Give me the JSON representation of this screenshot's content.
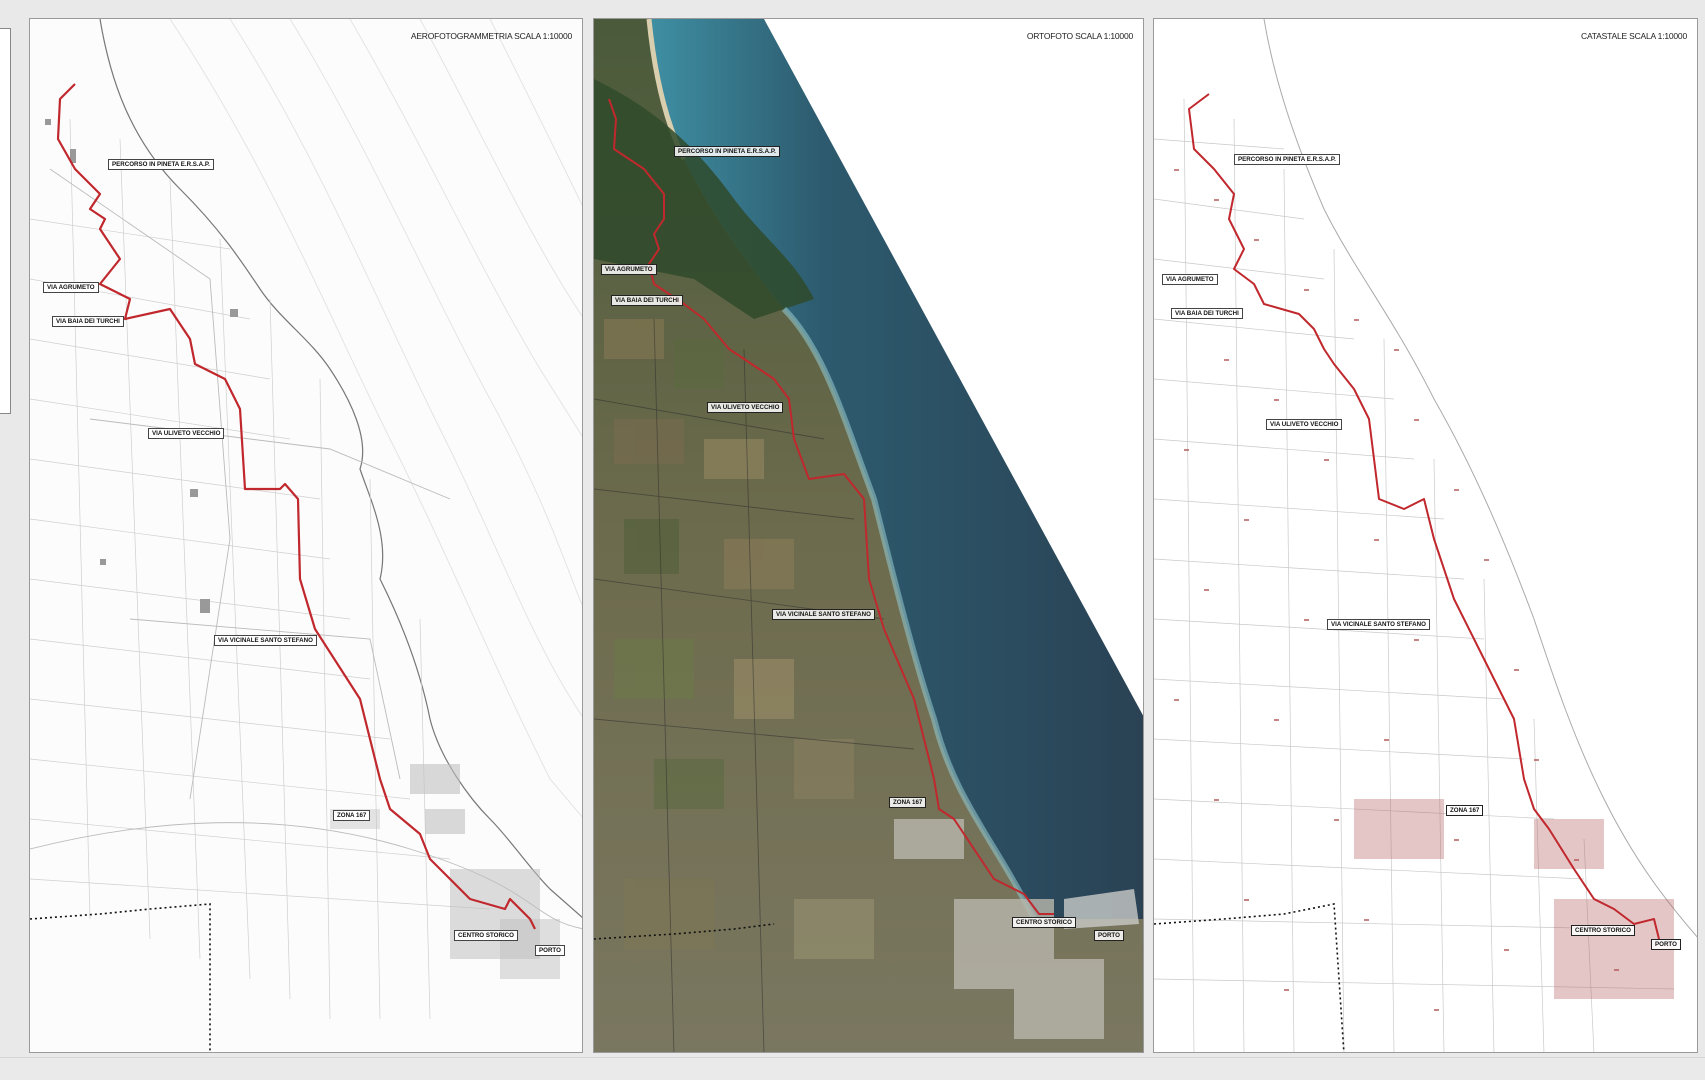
{
  "panels": [
    {
      "id": "aero",
      "title": "AEROFOTOGRAMMETRIA SCALA 1:10000"
    },
    {
      "id": "orto",
      "title": "ORTOFOTO SCALA 1:10000"
    },
    {
      "id": "cata",
      "title": "CATASTALE SCALA 1:10000"
    }
  ],
  "labels": {
    "pineta": "PERCORSO IN PINETA E.R.S.A.P.",
    "agrumeto": "VIA AGRUMETO",
    "baia": "VIA BAIA DEI TURCHI",
    "uliveto": "VIA ULIVETO VECCHIO",
    "stefano": "VIA VICINALE SANTO STEFANO",
    "zona": "ZONA 167",
    "centro": "CENTRO STORICO",
    "porto": "PORTO"
  },
  "colors": {
    "route": "#c0282d",
    "sea_dark": "#2f4a5e",
    "sea_light": "#3f8fa3",
    "land": "#6d6b4d",
    "cadastral": "#b35c5c",
    "boundary": "#111111"
  }
}
